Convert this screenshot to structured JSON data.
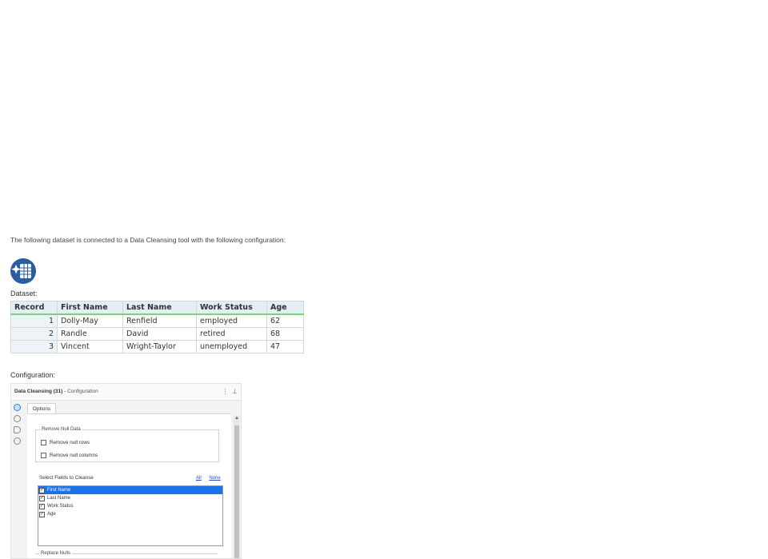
{
  "intro_text": "The following dataset is connected to a Data Cleansing tool with the following configuration:",
  "dataset_label": "Dataset:",
  "configuration_label": "Configuration:",
  "dataset": {
    "headers": [
      "Record",
      "First Name",
      "Last Name",
      "Work Status",
      "Age"
    ],
    "rows": [
      [
        "1",
        "Dolly-May",
        "Renfield",
        "employed",
        "62"
      ],
      [
        "2",
        "Randle",
        "David",
        "retired",
        "68"
      ],
      [
        "3",
        "Vincent",
        "Wright-Taylor",
        "unemployed",
        "47"
      ]
    ]
  },
  "panel": {
    "title": "Data Cleansing (31)",
    "subtitle": " - Configuration",
    "tab_label": "Options",
    "remove_null_group": "Remove Null Data",
    "remove_null_rows": "Remove null rows",
    "remove_null_columns": "Remove null columns",
    "select_fields_label": "Select Fields to Cleanse",
    "all_link": "All",
    "none_link": "None",
    "fields": [
      {
        "name": "First Name",
        "checked": true,
        "selected": true
      },
      {
        "name": "Last Name",
        "checked": true,
        "selected": false
      },
      {
        "name": "Work Status",
        "checked": true,
        "selected": false
      },
      {
        "name": "Age",
        "checked": true,
        "selected": false
      }
    ],
    "replace_nulls_label": "Replace Nulls"
  },
  "colors": {
    "header_underline": "#7ccf7c",
    "selection": "#1a73e8",
    "link": "#1f4dd1",
    "icon_blue": "#2a5d9f"
  }
}
